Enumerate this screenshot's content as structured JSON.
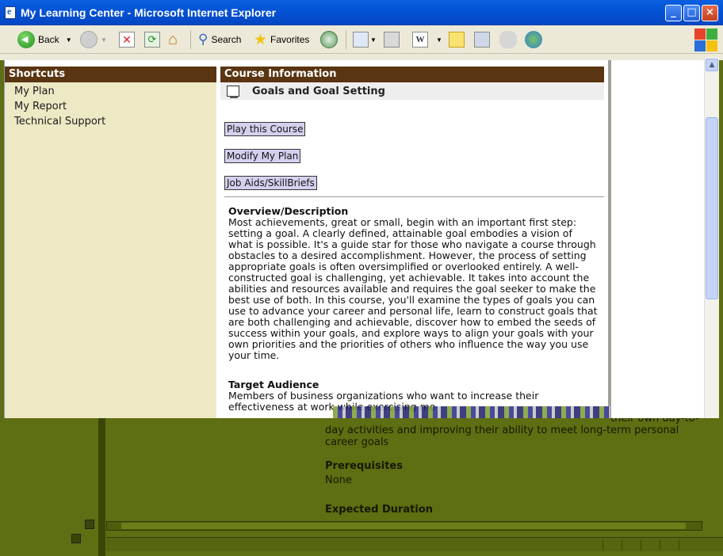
{
  "window": {
    "title": "My Learning Center - Microsoft Internet Explorer",
    "minimize": "_",
    "maximize": "□",
    "close": "×"
  },
  "toolbar": {
    "back_label": "Back",
    "search_label": "Search",
    "favorites_label": "Favorites"
  },
  "shortcuts": {
    "header": "Shortcuts",
    "items": [
      "My Plan",
      "My Report",
      "Technical Support"
    ]
  },
  "course": {
    "header": "Course Information",
    "name": "Goals and Goal Setting",
    "buttons": [
      "Play this Course",
      "Modify My Plan",
      "Job Aids/SkillBriefs"
    ],
    "overview_heading": "Overview/Description",
    "overview_text": "Most achievements, great or small, begin with an important first step: setting a goal. A clearly defined, attainable goal embodies a vision of what is possible. It's a guide star for those who navigate a course through obstacles to a desired accomplishment. However, the process of setting appropriate goals is often oversimplified or overlooked entirely. A well-constructed goal is challenging, yet achievable. It takes into account the abilities and resources available and requires the goal seeker to make the best use of both. In this course, you'll examine the types of goals you can use to advance your career and personal life, learn to construct goals that are both challenging and achievable, discover how to embed the seeds of success within your goals, and explore ways to align your goals with your own priorities and the priorities of others who influence the way you use your time.",
    "audience_heading": "Target Audience",
    "audience_text": "Members of business organizations who want to increase their effectiveness at work while exercising mo"
  },
  "lower": {
    "continued_text": "their own day-to-day activities and improving their ability to meet long-term personal career goals",
    "prereq_heading": "Prerequisites",
    "prereq_value": "None",
    "duration_heading": "Expected Duration"
  },
  "colors": {
    "titlebar": "#0453d6",
    "panel_header": "#5a3512",
    "shortcut_bg": "#ede9c5",
    "button_bg": "#d6d0ef",
    "lower_bg": "#5e6e12"
  }
}
